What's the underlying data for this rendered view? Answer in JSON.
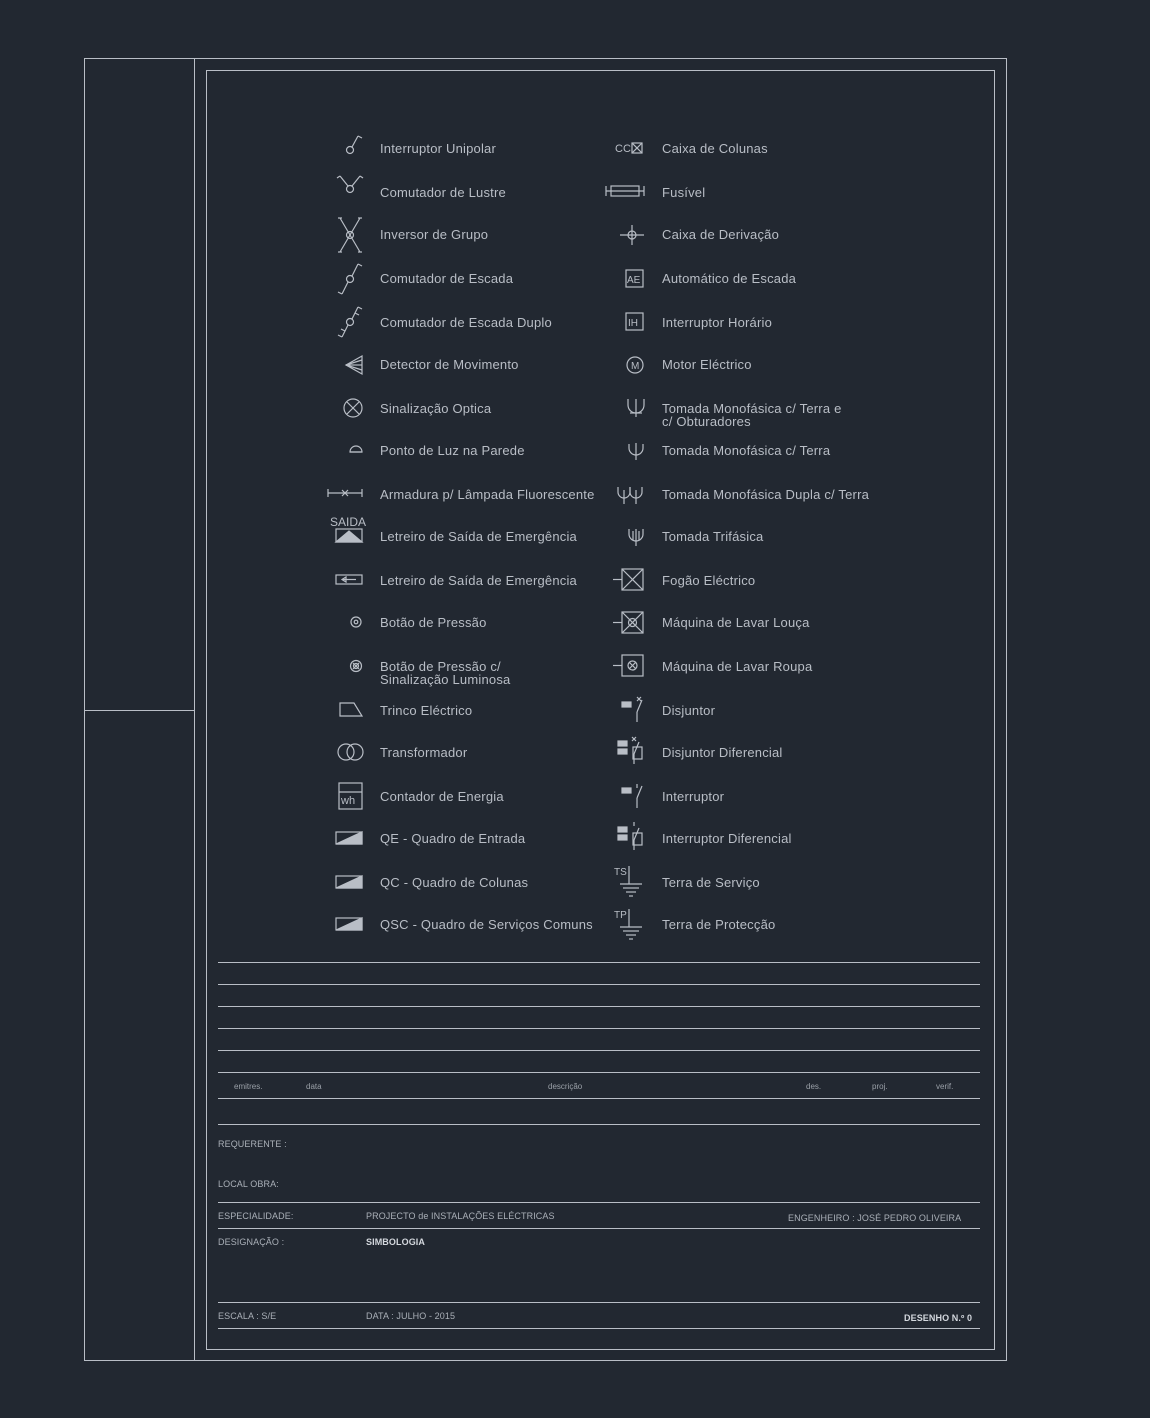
{
  "legend_left": [
    {
      "icon": "single-pole-switch-icon",
      "label": "Interruptor Unipolar"
    },
    {
      "icon": "chandelier-switch-icon",
      "label": "Comutador de Lustre"
    },
    {
      "icon": "group-inverter-icon",
      "label": "Inversor de Grupo"
    },
    {
      "icon": "stair-switch-icon",
      "label": "Comutador de Escada"
    },
    {
      "icon": "double-stair-switch-icon",
      "label": "Comutador de Escada Duplo"
    },
    {
      "icon": "motion-detector-icon",
      "label": "Detector de Movimento"
    },
    {
      "icon": "optical-signal-icon",
      "label": "Sinalização Optica"
    },
    {
      "icon": "wall-light-point-icon",
      "label": "Ponto de Luz na Parede"
    },
    {
      "icon": "fluorescent-fixture-icon",
      "label": "Armadura p/ Lâmpada Fluorescente"
    },
    {
      "icon": "exit-sign-icon",
      "label": "Letreiro de Saída de Emergência",
      "tag": "SAIDA"
    },
    {
      "icon": "exit-sign-arrow-icon",
      "label": "Letreiro de Saída de Emergência"
    },
    {
      "icon": "push-button-icon",
      "label": "Botão de Pressão"
    },
    {
      "icon": "lit-push-button-icon",
      "label": "Botão de Pressão c/ Sinalização Luminosa"
    },
    {
      "icon": "electric-latch-icon",
      "label": "Trinco Eléctrico"
    },
    {
      "icon": "transformer-icon",
      "label": "Transformador"
    },
    {
      "icon": "energy-meter-icon",
      "label": "Contador de Energia",
      "tag": "wh"
    },
    {
      "icon": "entry-panel-icon",
      "label": "QE - Quadro de Entrada"
    },
    {
      "icon": "column-panel-icon",
      "label": "QC - Quadro de Colunas"
    },
    {
      "icon": "common-services-panel-icon",
      "label": "QSC - Quadro de Serviços Comuns"
    }
  ],
  "legend_right": [
    {
      "icon": "column-box-icon",
      "label": "Caixa de Colunas",
      "tag": "CC"
    },
    {
      "icon": "fuse-icon",
      "label": "Fusível"
    },
    {
      "icon": "junction-box-icon",
      "label": "Caixa de Derivação"
    },
    {
      "icon": "stair-timer-icon",
      "label": "Automático de Escada",
      "tag": "AE"
    },
    {
      "icon": "time-switch-icon",
      "label": "Interruptor Horário",
      "tag": "IH"
    },
    {
      "icon": "electric-motor-icon",
      "label": "Motor Eléctrico",
      "tag": "M"
    },
    {
      "icon": "shuttered-socket-icon",
      "label": "Tomada Monofásica c/ Terra e c/ Obturadores"
    },
    {
      "icon": "earthed-socket-icon",
      "label": "Tomada Monofásica c/ Terra"
    },
    {
      "icon": "double-socket-icon",
      "label": "Tomada Monofásica Dupla c/ Terra"
    },
    {
      "icon": "three-phase-socket-icon",
      "label": "Tomada Trifásica"
    },
    {
      "icon": "electric-stove-icon",
      "label": "Fogão Eléctrico"
    },
    {
      "icon": "dishwasher-icon",
      "label": "Máquina de Lavar Louça"
    },
    {
      "icon": "washing-machine-icon",
      "label": "Máquina de Lavar Roupa"
    },
    {
      "icon": "circuit-breaker-icon",
      "label": "Disjuntor"
    },
    {
      "icon": "differential-breaker-icon",
      "label": "Disjuntor Diferencial"
    },
    {
      "icon": "switch-icon",
      "label": "Interruptor"
    },
    {
      "icon": "differential-switch-icon",
      "label": "Interruptor Diferencial"
    },
    {
      "icon": "service-earth-icon",
      "label": "Terra de Serviço",
      "tag": "TS"
    },
    {
      "icon": "protection-earth-icon",
      "label": "Terra de Protecção",
      "tag": "TP"
    }
  ],
  "revision_table": {
    "headers": [
      "emitres.",
      "data",
      "descrição",
      "des.",
      "proj.",
      "verif."
    ]
  },
  "title_block": {
    "requerente_label": "REQUERENTE :",
    "local_label": "LOCAL OBRA:",
    "especialidade_label": "ESPECIALIDADE:",
    "especialidade_value": "PROJECTO de INSTALAÇÕES ELÉCTRICAS",
    "engenheiro": "ENGENHEIRO : JOSÉ PEDRO OLIVEIRA",
    "designacao_label": "DESIGNAÇÃO :",
    "designacao_value": "SIMBOLOGIA",
    "escala": "ESCALA : S/E",
    "data": "DATA : JULHO - 2015",
    "desenho": "DESENHO N.º 0"
  },
  "colors": {
    "background": "#222831",
    "line": "#b9bec6"
  }
}
